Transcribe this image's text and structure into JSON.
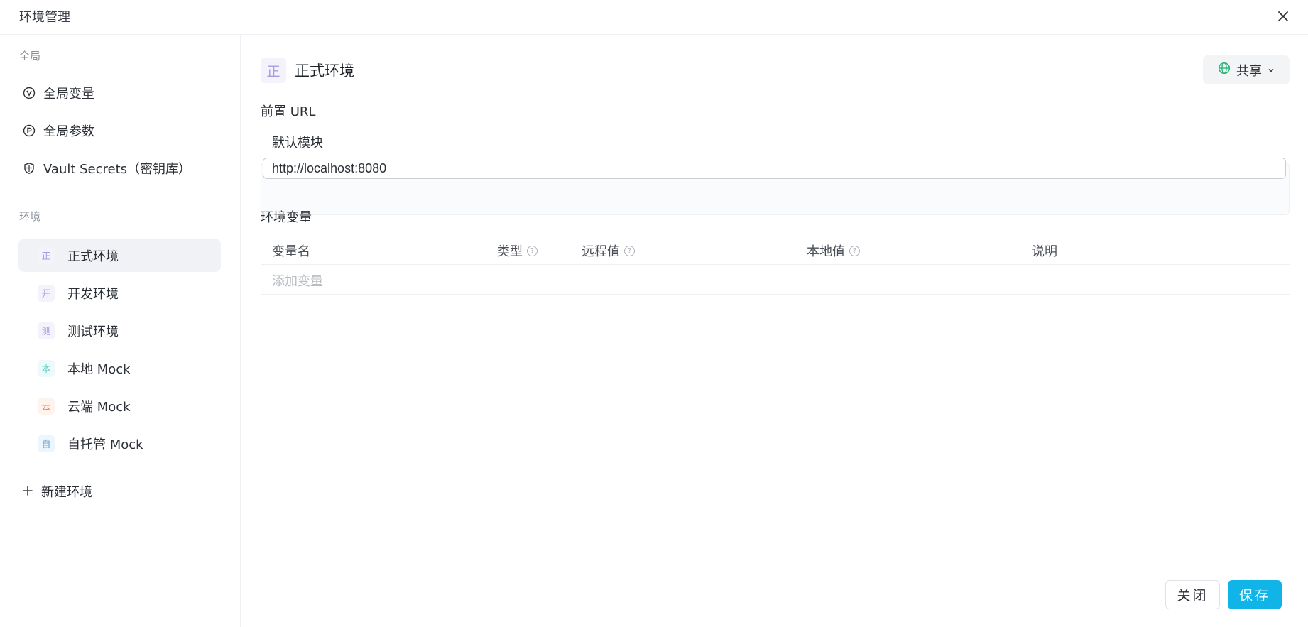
{
  "window": {
    "title": "环境管理"
  },
  "sidebar": {
    "global_section": "全局",
    "global_items": [
      {
        "label": "全局变量",
        "icon": "v-circle-icon"
      },
      {
        "label": "全局参数",
        "icon": "p-circle-icon"
      },
      {
        "label": "Vault Secrets（密钥库）",
        "icon": "shield-icon"
      }
    ],
    "env_section": "环境",
    "environments": [
      {
        "badge": "正",
        "label": "正式环境",
        "badge_color": "#a99be0",
        "badge_bg": "#f4f3fb",
        "active": true
      },
      {
        "badge": "开",
        "label": "开发环境",
        "badge_color": "#a99be0",
        "badge_bg": "#f4f3fb",
        "active": false
      },
      {
        "badge": "测",
        "label": "测试环境",
        "badge_color": "#a99be0",
        "badge_bg": "#f4f3fb",
        "active": false
      },
      {
        "badge": "本",
        "label": "本地 Mock",
        "badge_color": "#5ccfc7",
        "badge_bg": "#eefaf9",
        "active": false
      },
      {
        "badge": "云",
        "label": "云端 Mock",
        "badge_color": "#f08a5d",
        "badge_bg": "#fff3ed",
        "active": false
      },
      {
        "badge": "自",
        "label": "自托管 Mock",
        "badge_color": "#5aa8e6",
        "badge_bg": "#eef6fd",
        "active": false
      }
    ],
    "new_env_label": "新建环境"
  },
  "main": {
    "env_badge": "正",
    "env_name": "正式环境",
    "share_label": "共享",
    "base_url_label": "前置 URL",
    "module_name": "默认模块",
    "base_url_value": "http://localhost:8080",
    "vars_label": "环境变量",
    "columns": [
      "变量名",
      "类型",
      "远程值",
      "本地值",
      "说明"
    ],
    "add_var_placeholder": "添加变量"
  },
  "footer": {
    "close_label": "关闭",
    "save_label": "保存"
  },
  "colors": {
    "accent": "#11b4e6",
    "share_icon": "#22b573"
  }
}
